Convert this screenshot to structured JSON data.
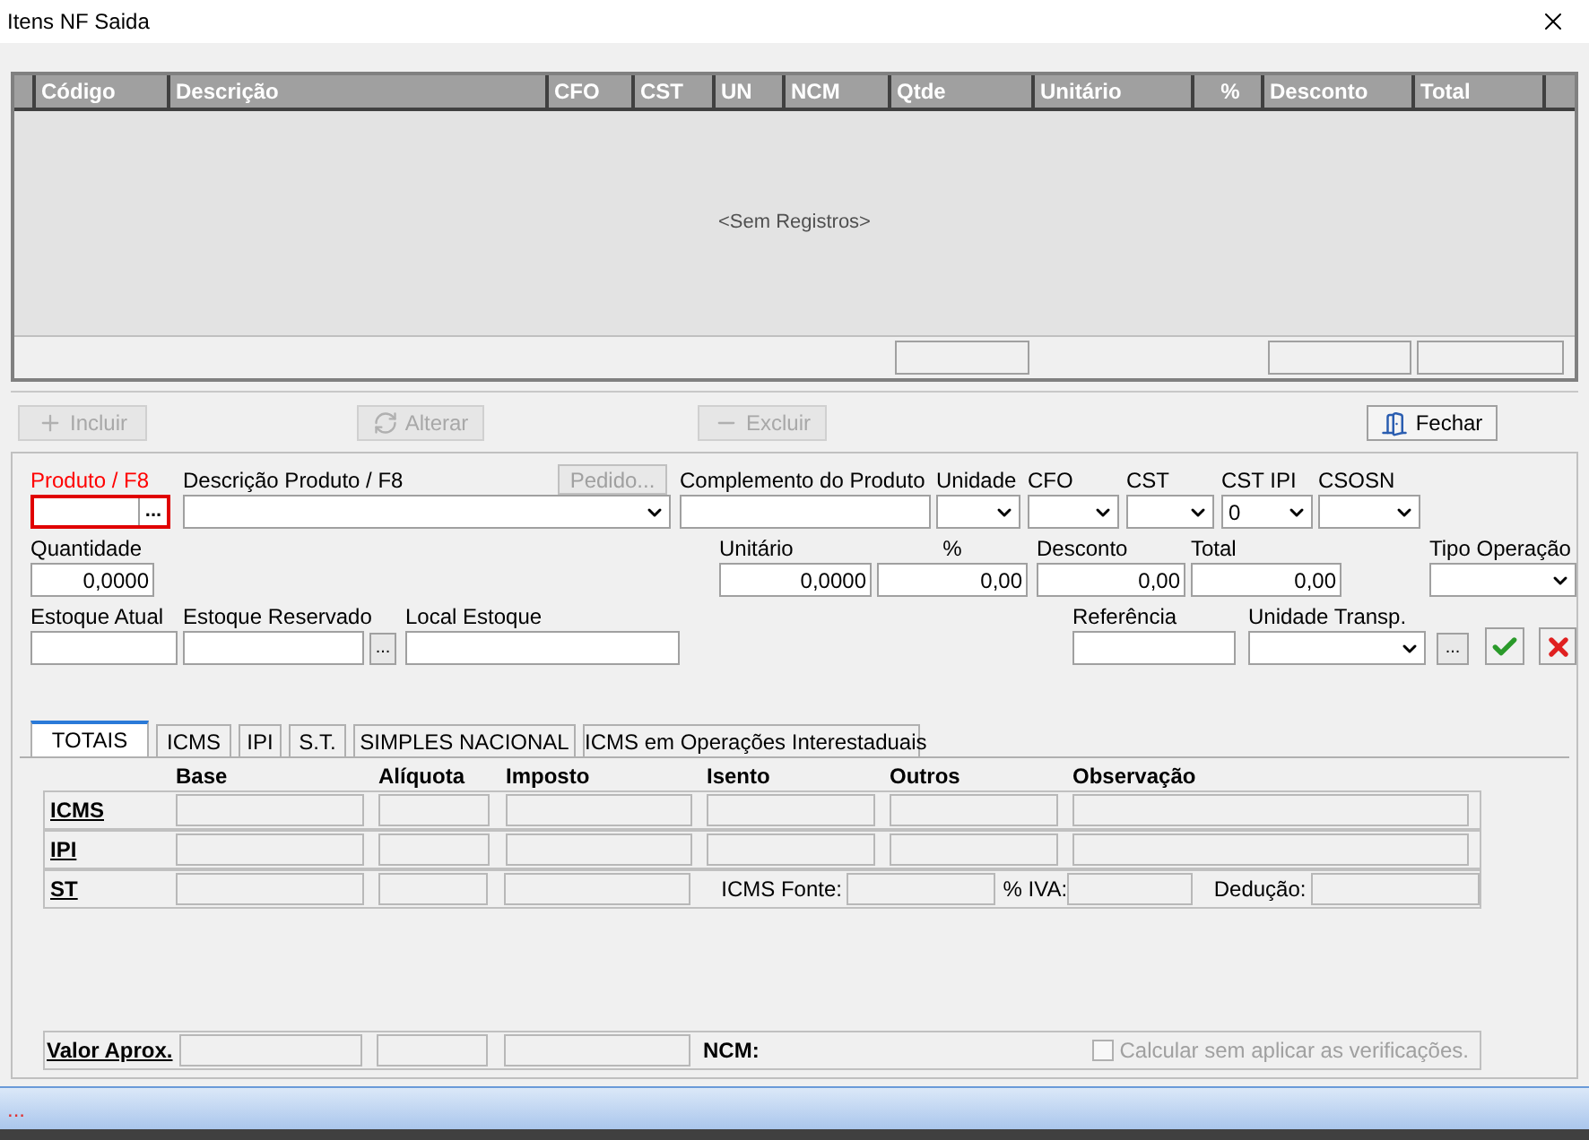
{
  "window": {
    "title": "Itens NF Saida"
  },
  "grid": {
    "columns": [
      "Código",
      "Descrição",
      "CFO",
      "CST",
      "UN",
      "NCM",
      "Qtde",
      "Unitário",
      "%",
      "Desconto",
      "Total"
    ],
    "empty_text": "<Sem Registros>"
  },
  "actions": [
    {
      "label": "Incluir",
      "kind": "plus",
      "disabled": true
    },
    {
      "label": "Alterar",
      "kind": "refresh",
      "disabled": true
    },
    {
      "label": "Excluir",
      "kind": "minus",
      "disabled": true
    },
    {
      "label": "Fechar",
      "kind": "door",
      "disabled": false
    }
  ],
  "pedido_button": {
    "label": "Pedido...",
    "disabled": true
  },
  "row_1": [
    {
      "label": "Produto / F8",
      "kind": "lookup",
      "lookup_button": "...",
      "focused": true
    },
    {
      "label": "Descrição Produto / F8",
      "kind": "combo",
      "focused": false
    },
    {
      "label": "Complemento do Produto",
      "kind": "text",
      "focused": false
    },
    {
      "label": "Unidade",
      "kind": "combo",
      "focused": false
    },
    {
      "label": "CFO",
      "kind": "combo",
      "focused": false
    },
    {
      "label": "CST",
      "kind": "combo",
      "focused": false
    },
    {
      "label": "CST IPI",
      "kind": "combo",
      "value": "0",
      "focused": false
    },
    {
      "label": "CSOSN",
      "kind": "combo",
      "focused": false
    }
  ],
  "row_2": [
    {
      "label": "Quantidade",
      "kind": "number",
      "value": "0,0000"
    },
    {
      "label": "Unitário",
      "kind": "number",
      "value": "0,0000"
    },
    {
      "label": "%",
      "kind": "number",
      "value": "0,00"
    },
    {
      "label": "Desconto",
      "kind": "number",
      "value": "0,00"
    },
    {
      "label": "Total",
      "kind": "number",
      "value": "0,00"
    },
    {
      "label": "Tipo Operação",
      "kind": "combo"
    }
  ],
  "row_3": [
    {
      "label": "Estoque Atual",
      "kind": "text"
    },
    {
      "label": "Estoque Reservado",
      "kind": "text"
    },
    {
      "label": "...",
      "kind": "dots"
    },
    {
      "label": "Local Estoque",
      "kind": "text"
    },
    {
      "label": "Referência",
      "kind": "text"
    },
    {
      "label": "Unidade Transp.",
      "kind": "combo"
    },
    {
      "label": "...",
      "kind": "dots"
    },
    {
      "kind": "confirm"
    },
    {
      "kind": "cancel"
    }
  ],
  "tabs": [
    {
      "label": "TOTAIS",
      "selected": true
    },
    {
      "label": "ICMS",
      "selected": false
    },
    {
      "label": "IPI",
      "selected": false
    },
    {
      "label": "S.T.",
      "selected": false
    },
    {
      "label": "SIMPLES NACIONAL",
      "selected": false
    },
    {
      "label": "ICMS em Operações Interestaduais",
      "selected": false
    }
  ],
  "totals": {
    "columns": [
      "Base",
      "Alíquota",
      "Imposto",
      "Isento",
      "Outros",
      "Observação"
    ],
    "rows": [
      {
        "label": "ICMS",
        "kind": "full"
      },
      {
        "label": "IPI",
        "kind": "full"
      },
      {
        "label": "ST",
        "kind": "st",
        "extras": [
          "ICMS Fonte:",
          "% IVA:",
          "Dedução:"
        ]
      }
    ]
  },
  "valor_aprox": {
    "label": "Valor Aprox.",
    "ncm_label": "NCM:",
    "checkbox": {
      "label": "Calcular sem aplicar as verificações.",
      "checked": false,
      "disabled": true
    }
  },
  "status_bar": {
    "text": "..."
  }
}
